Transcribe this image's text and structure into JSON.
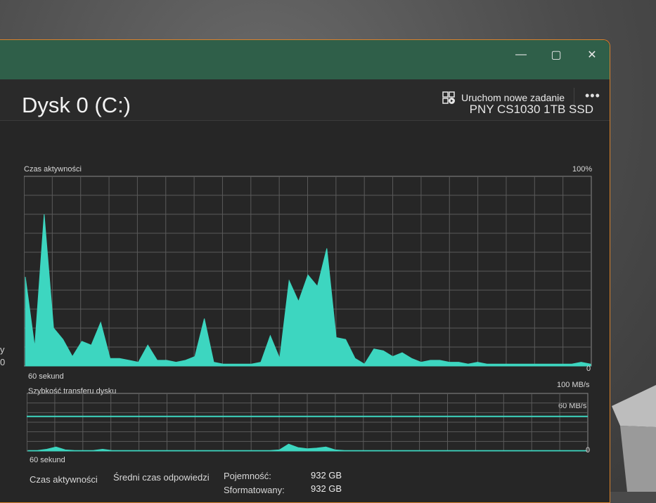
{
  "window": {
    "controls": {
      "minimize": "—",
      "maximize": "▢",
      "close": "✕"
    }
  },
  "toolbar": {
    "run_task_label": "Uruchom nowe zadanie",
    "run_task_icon": "run-task-icon",
    "more_label": "•••"
  },
  "disk": {
    "title": "Dysk 0 (C:)",
    "model": "PNY CS1030 1TB SSD"
  },
  "activity_chart": {
    "label": "Czas aktywności",
    "max_label": "100%",
    "min_label": "0",
    "time_label": "60 sekund"
  },
  "transfer_chart": {
    "label": "Szybkość transferu dysku",
    "max_label": "100 MB/s",
    "ref_label": "60 MB/s",
    "min_label": "0",
    "time_label": "60 sekund"
  },
  "stats": {
    "active_time_label": "Czas aktywności",
    "avg_response_label": "Średni czas odpowiedzi",
    "capacity_label": "Pojemność:",
    "capacity_value": "932 GB",
    "formatted_label": "Sformatowany:",
    "formatted_value": "932 GB"
  },
  "left_fragments": [
    "y",
    "0"
  ],
  "colors": {
    "accent": "#3dd6c0",
    "titlebar": "#2f5f49",
    "window_border": "#d9822b",
    "background": "#262626"
  },
  "chart_data": [
    {
      "type": "area",
      "title": "Czas aktywności",
      "ylabel": "",
      "ylim": [
        0,
        100
      ],
      "x": [
        60,
        59,
        58,
        57,
        56,
        55,
        54,
        53,
        52,
        51,
        50,
        49,
        48,
        47,
        46,
        45,
        44,
        43,
        42,
        41,
        40,
        39,
        38,
        37,
        36,
        35,
        34,
        33,
        32,
        31,
        30,
        29,
        28,
        27,
        26,
        25,
        24,
        23,
        22,
        21,
        20,
        19,
        18,
        17,
        16,
        15,
        14,
        13,
        12,
        11,
        10,
        9,
        8,
        7,
        6,
        5,
        4,
        3,
        2,
        1,
        0
      ],
      "series": [
        {
          "values": [
            47,
            10,
            80,
            20,
            14,
            5,
            13,
            11,
            23,
            4,
            4,
            3,
            2,
            11,
            3,
            3,
            2,
            3,
            5,
            25,
            2,
            1,
            1,
            1,
            1,
            2,
            16,
            4,
            45,
            34,
            48,
            42,
            62,
            15,
            14,
            4,
            1,
            9,
            8,
            5,
            7,
            4,
            2,
            3,
            3,
            2,
            2,
            1,
            2,
            1,
            1,
            1,
            1,
            1,
            1,
            1,
            1,
            1,
            1,
            2,
            1
          ]
        }
      ]
    },
    {
      "type": "line",
      "title": "Szybkość transferu dysku",
      "ylabel": "",
      "ylim": [
        0,
        100
      ],
      "x": [
        60,
        59,
        58,
        57,
        56,
        55,
        54,
        53,
        52,
        51,
        50,
        49,
        48,
        47,
        46,
        45,
        44,
        43,
        42,
        41,
        40,
        39,
        38,
        37,
        36,
        35,
        34,
        33,
        32,
        31,
        30,
        29,
        28,
        27,
        26,
        25,
        24,
        23,
        22,
        21,
        20,
        19,
        18,
        17,
        16,
        15,
        14,
        13,
        12,
        11,
        10,
        9,
        8,
        7,
        6,
        5,
        4,
        3,
        2,
        1,
        0
      ],
      "series": [
        {
          "values": [
            1,
            1,
            3,
            7,
            2,
            1,
            1,
            1,
            3,
            1,
            1,
            1,
            1,
            1,
            1,
            1,
            1,
            1,
            1,
            1,
            1,
            1,
            1,
            1,
            1,
            1,
            1,
            2,
            12,
            6,
            4,
            5,
            7,
            2,
            1,
            1,
            1,
            1,
            1,
            1,
            1,
            1,
            1,
            1,
            1,
            1,
            1,
            1,
            1,
            1,
            1,
            1,
            1,
            1,
            1,
            1,
            1,
            1,
            1,
            1,
            1
          ]
        }
      ],
      "reference_lines": [
        60
      ]
    }
  ]
}
